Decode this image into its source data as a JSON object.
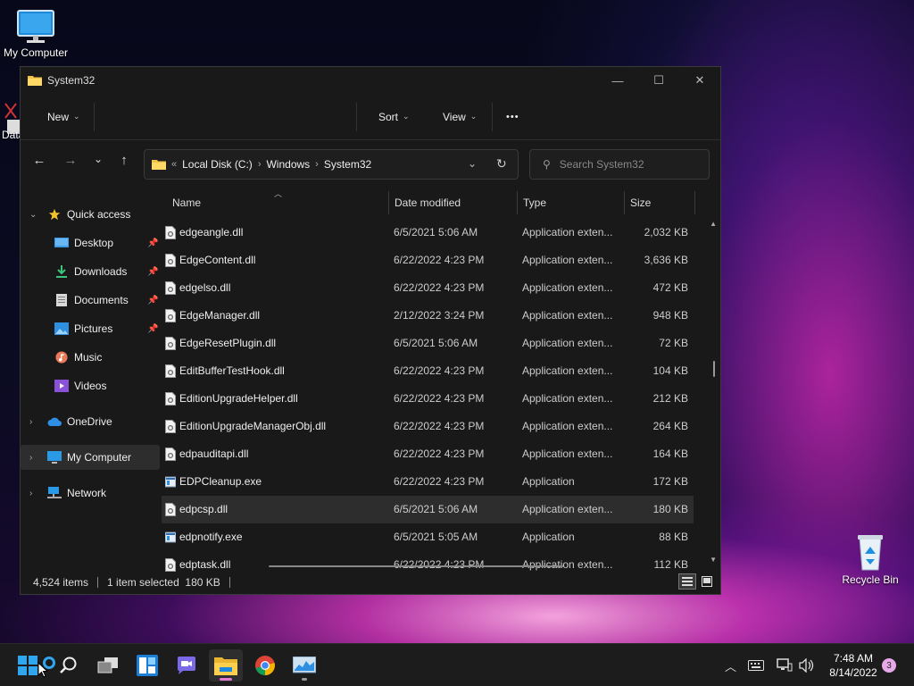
{
  "desktop": {
    "icons": [
      {
        "label": "My Computer"
      },
      {
        "label": "Data"
      },
      {
        "label": "Recycle Bin"
      }
    ]
  },
  "window": {
    "title": "System32",
    "controls": {
      "minimize": "—",
      "maximize": "☐",
      "close": "✕"
    }
  },
  "toolbar": {
    "new_label": "New",
    "sort_label": "Sort",
    "view_label": "View",
    "more_label": "•••"
  },
  "address": {
    "crumbs": [
      "Local Disk (C:)",
      "Windows",
      "System32"
    ]
  },
  "search": {
    "placeholder": "Search System32"
  },
  "sidebar": {
    "items": [
      {
        "label": "Quick access",
        "icon": "star-icon"
      },
      {
        "label": "Desktop",
        "icon": "desktop-folder-icon",
        "pinned": true
      },
      {
        "label": "Downloads",
        "icon": "download-icon",
        "pinned": true
      },
      {
        "label": "Documents",
        "icon": "documents-icon",
        "pinned": true
      },
      {
        "label": "Pictures",
        "icon": "pictures-icon",
        "pinned": true
      },
      {
        "label": "Music",
        "icon": "music-icon"
      },
      {
        "label": "Videos",
        "icon": "videos-icon"
      },
      {
        "label": "OneDrive",
        "icon": "cloud-icon"
      },
      {
        "label": "My Computer",
        "icon": "computer-icon",
        "selected": true
      },
      {
        "label": "Network",
        "icon": "network-icon"
      }
    ]
  },
  "columns": {
    "name": "Name",
    "date": "Date modified",
    "type": "Type",
    "size": "Size"
  },
  "files": [
    {
      "name": "edgeangle.dll",
      "date": "6/5/2021 5:06 AM",
      "type": "Application exten...",
      "size": "2,032 KB",
      "kind": "dll"
    },
    {
      "name": "EdgeContent.dll",
      "date": "6/22/2022 4:23 PM",
      "type": "Application exten...",
      "size": "3,636 KB",
      "kind": "dll"
    },
    {
      "name": "edgelso.dll",
      "date": "6/22/2022 4:23 PM",
      "type": "Application exten...",
      "size": "472 KB",
      "kind": "dll"
    },
    {
      "name": "EdgeManager.dll",
      "date": "2/12/2022 3:24 PM",
      "type": "Application exten...",
      "size": "948 KB",
      "kind": "dll"
    },
    {
      "name": "EdgeResetPlugin.dll",
      "date": "6/5/2021 5:06 AM",
      "type": "Application exten...",
      "size": "72 KB",
      "kind": "dll"
    },
    {
      "name": "EditBufferTestHook.dll",
      "date": "6/22/2022 4:23 PM",
      "type": "Application exten...",
      "size": "104 KB",
      "kind": "dll"
    },
    {
      "name": "EditionUpgradeHelper.dll",
      "date": "6/22/2022 4:23 PM",
      "type": "Application exten...",
      "size": "212 KB",
      "kind": "dll"
    },
    {
      "name": "EditionUpgradeManagerObj.dll",
      "date": "6/22/2022 4:23 PM",
      "type": "Application exten...",
      "size": "264 KB",
      "kind": "dll"
    },
    {
      "name": "edpauditapi.dll",
      "date": "6/22/2022 4:23 PM",
      "type": "Application exten...",
      "size": "164 KB",
      "kind": "dll"
    },
    {
      "name": "EDPCleanup.exe",
      "date": "6/22/2022 4:23 PM",
      "type": "Application",
      "size": "172 KB",
      "kind": "exe"
    },
    {
      "name": "edpcsp.dll",
      "date": "6/5/2021 5:06 AM",
      "type": "Application exten...",
      "size": "180 KB",
      "kind": "dll",
      "selected": true
    },
    {
      "name": "edpnotify.exe",
      "date": "6/5/2021 5:05 AM",
      "type": "Application",
      "size": "88 KB",
      "kind": "exe"
    },
    {
      "name": "edptask.dll",
      "date": "6/22/2022 4:23 PM",
      "type": "Application exten...",
      "size": "112 KB",
      "kind": "dll"
    }
  ],
  "status": {
    "item_count": "4,524 items",
    "selection": "1 item selected  180 KB"
  },
  "taskbar": {
    "apps": [
      "start-icon",
      "search-icon",
      "task-view-icon",
      "widgets-icon",
      "chat-icon",
      "file-explorer-icon",
      "chrome-icon",
      "resource-monitor-icon"
    ],
    "time": "7:48 AM",
    "date": "8/14/2022",
    "notifications": "3"
  },
  "colors": {
    "window_bg": "#191919",
    "selection": "#2d2d2d",
    "accent": "#e07ad0"
  }
}
